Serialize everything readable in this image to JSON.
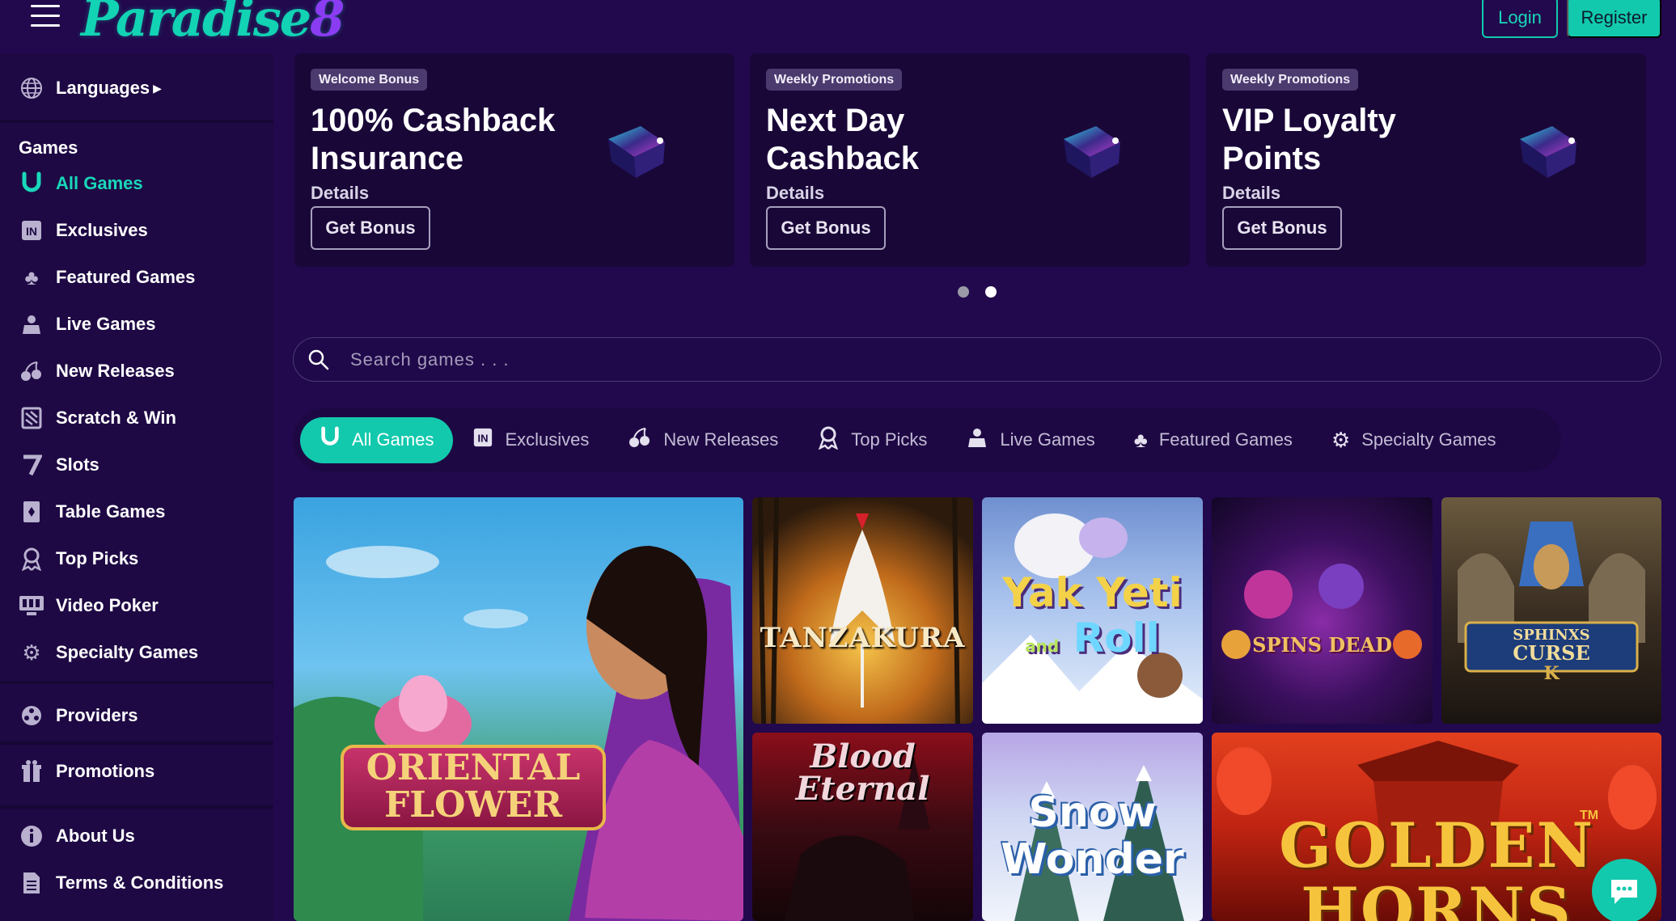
{
  "brand": {
    "logo_text": "Paradise",
    "logo_num": "8"
  },
  "header": {
    "login": "Login",
    "register": "Register"
  },
  "sidebar": {
    "languages": "Languages",
    "games_heading": "Games",
    "items": [
      {
        "label": "All Games",
        "icon": "horseshoe-icon"
      },
      {
        "label": "Exclusives",
        "icon": "exclusive-icon"
      },
      {
        "label": "Featured Games",
        "icon": "clover-icon"
      },
      {
        "label": "Live Games",
        "icon": "dealer-icon"
      },
      {
        "label": "New Releases",
        "icon": "cherries-icon"
      },
      {
        "label": "Scratch & Win",
        "icon": "scratch-icon"
      },
      {
        "label": "Slots",
        "icon": "seven-icon"
      },
      {
        "label": "Table Games",
        "icon": "cards-icon"
      },
      {
        "label": "Top Picks",
        "icon": "award-icon"
      },
      {
        "label": "Video Poker",
        "icon": "monitor-icon"
      },
      {
        "label": "Specialty Games",
        "icon": "gear-icon"
      }
    ],
    "providers": "Providers",
    "promotions": "Promotions",
    "about": "About Us",
    "terms": "Terms & Conditions"
  },
  "promos": [
    {
      "badge": "Welcome Bonus",
      "title": "100% Cashback Insurance",
      "details": "Details",
      "button": "Get Bonus"
    },
    {
      "badge": "Weekly Promotions",
      "title": "Next Day Cashback",
      "details": "Details",
      "button": "Get Bonus"
    },
    {
      "badge": "Weekly Promotions",
      "title": "VIP Loyalty Points",
      "details": "Details",
      "button": "Get Bonus"
    }
  ],
  "carousel": {
    "pages": 2,
    "active": 2
  },
  "search": {
    "placeholder": "Search games . . ."
  },
  "tabs": [
    {
      "label": "All Games",
      "icon": "horseshoe-icon"
    },
    {
      "label": "Exclusives",
      "icon": "exclusive-icon"
    },
    {
      "label": "New Releases",
      "icon": "cherries-icon"
    },
    {
      "label": "Top Picks",
      "icon": "award-icon"
    },
    {
      "label": "Live Games",
      "icon": "dealer-icon"
    },
    {
      "label": "Featured Games",
      "icon": "clover-icon"
    },
    {
      "label": "Specialty Games",
      "icon": "gear-icon"
    }
  ],
  "games": {
    "oriental": {
      "line1": "ORIENTAL",
      "line2": "FLOWER"
    },
    "tanzakura": "TANZAKURA",
    "yakyeti": {
      "line1": "Yak Yeti",
      "line2": "and",
      "line3": "Roll"
    },
    "spins": "SPINS DEAD",
    "sphinx": {
      "line1": "SPHINXS",
      "line2": "CURSE",
      "line3": "K"
    },
    "blood": {
      "line1": "Blood",
      "line2": "Eternal"
    },
    "snow": {
      "line1": "Snow",
      "line2": "Wonder"
    },
    "golden": {
      "line1": "GOLDEN",
      "line2": "HORNS",
      "tm": "TM"
    }
  },
  "colors": {
    "accent": "#12c9ad",
    "background": "#22094d",
    "sidebar": "#1e0944"
  }
}
